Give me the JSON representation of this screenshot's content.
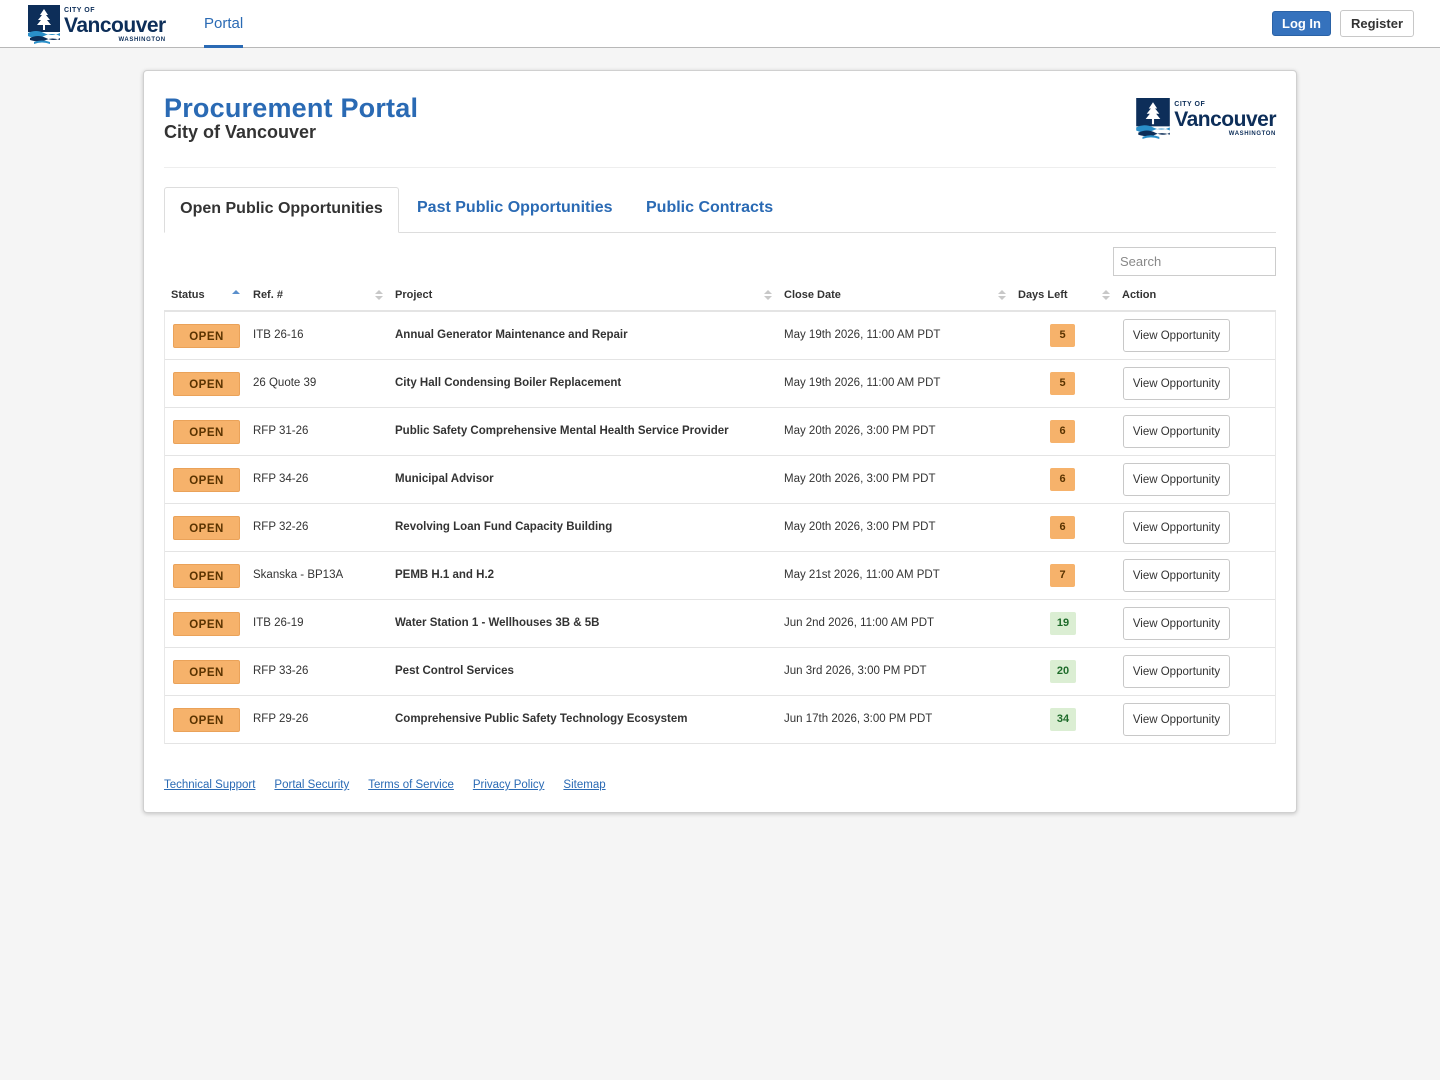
{
  "nav": {
    "logo": {
      "city_of": "CITY OF",
      "name": "Vancouver",
      "state": "WASHINGTON"
    },
    "portal_link": "Portal",
    "login_label": "Log In",
    "register_label": "Register"
  },
  "header": {
    "title": "Procurement Portal",
    "subtitle": "City of Vancouver",
    "logo": {
      "city_of": "CITY OF",
      "name": "Vancouver",
      "state": "WASHINGTON"
    }
  },
  "tabs": [
    {
      "label": "Open Public Opportunities",
      "active": true
    },
    {
      "label": "Past Public Opportunities",
      "active": false
    },
    {
      "label": "Public Contracts",
      "active": false
    }
  ],
  "search": {
    "placeholder": "Search",
    "value": ""
  },
  "table": {
    "columns": [
      "Status",
      "Ref. #",
      "Project",
      "Close Date",
      "Days Left",
      "Action"
    ],
    "sorted_column": "Status",
    "rows": [
      {
        "status": "OPEN",
        "ref": "ITB 26-16",
        "project": "Annual Generator Maintenance and Repair",
        "close_date": "May 19th 2026, 11:00 AM PDT",
        "days_left": "5",
        "level": "warn",
        "action": "View Opportunity"
      },
      {
        "status": "OPEN",
        "ref": "26 Quote 39",
        "project": "City Hall Condensing Boiler Replacement",
        "close_date": "May 19th 2026, 11:00 AM PDT",
        "days_left": "5",
        "level": "warn",
        "action": "View Opportunity"
      },
      {
        "status": "OPEN",
        "ref": "RFP 31-26",
        "project": "Public Safety Comprehensive Mental Health Service Provider",
        "close_date": "May 20th 2026, 3:00 PM PDT",
        "days_left": "6",
        "level": "warn",
        "action": "View Opportunity"
      },
      {
        "status": "OPEN",
        "ref": "RFP 34-26",
        "project": "Municipal Advisor",
        "close_date": "May 20th 2026, 3:00 PM PDT",
        "days_left": "6",
        "level": "warn",
        "action": "View Opportunity"
      },
      {
        "status": "OPEN",
        "ref": "RFP 32-26",
        "project": "Revolving Loan Fund Capacity Building",
        "close_date": "May 20th 2026, 3:00 PM PDT",
        "days_left": "6",
        "level": "warn",
        "action": "View Opportunity"
      },
      {
        "status": "OPEN",
        "ref": "Skanska - BP13A",
        "project": "PEMB H.1 and H.2",
        "close_date": "May 21st 2026, 11:00 AM PDT",
        "days_left": "7",
        "level": "warn",
        "action": "View Opportunity"
      },
      {
        "status": "OPEN",
        "ref": "ITB 26-19",
        "project": "Water Station 1 - Wellhouses 3B & 5B",
        "close_date": "Jun 2nd 2026, 11:00 AM PDT",
        "days_left": "19",
        "level": "ok",
        "action": "View Opportunity"
      },
      {
        "status": "OPEN",
        "ref": "RFP 33-26",
        "project": "Pest Control Services",
        "close_date": "Jun 3rd 2026, 3:00 PM PDT",
        "days_left": "20",
        "level": "ok",
        "action": "View Opportunity"
      },
      {
        "status": "OPEN",
        "ref": "RFP 29-26",
        "project": "Comprehensive Public Safety Technology Ecosystem",
        "close_date": "Jun 17th 2026, 3:00 PM PDT",
        "days_left": "34",
        "level": "ok",
        "action": "View Opportunity"
      }
    ]
  },
  "footer": {
    "links": [
      "Technical Support",
      "Portal Security",
      "Terms of Service",
      "Privacy Policy",
      "Sitemap"
    ]
  },
  "colors": {
    "brand_blue": "#2a6ab4",
    "logo_navy": "#0d2e59",
    "open_badge": "#f6b26b",
    "days_ok": "#dbeed3"
  }
}
